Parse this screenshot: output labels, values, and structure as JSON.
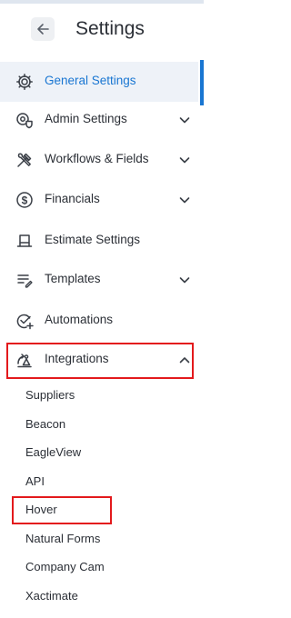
{
  "header": {
    "title": "Settings"
  },
  "colors": {
    "accent": "#1976d2",
    "highlight": "#e3191c"
  },
  "menu": [
    {
      "label": "General Settings",
      "icon": "gear-icon",
      "active": true,
      "chevron": "none"
    },
    {
      "label": "Admin Settings",
      "icon": "admin-gear-shield-icon",
      "chevron": "down"
    },
    {
      "label": "Workflows & Fields",
      "icon": "tools-icon",
      "chevron": "down"
    },
    {
      "label": "Financials",
      "icon": "dollar-circle-icon",
      "chevron": "down"
    },
    {
      "label": "Estimate Settings",
      "icon": "estimate-icon",
      "chevron": "none"
    },
    {
      "label": "Templates",
      "icon": "templates-icon",
      "chevron": "down"
    },
    {
      "label": "Automations",
      "icon": "automation-check-icon",
      "chevron": "none"
    },
    {
      "label": "Integrations",
      "icon": "integrations-icon",
      "chevron": "up",
      "expanded": true
    }
  ],
  "integrations_submenu": [
    "Suppliers",
    "Beacon",
    "EagleView",
    "API",
    "Hover",
    "Natural Forms",
    "Company Cam",
    "Xactimate"
  ]
}
